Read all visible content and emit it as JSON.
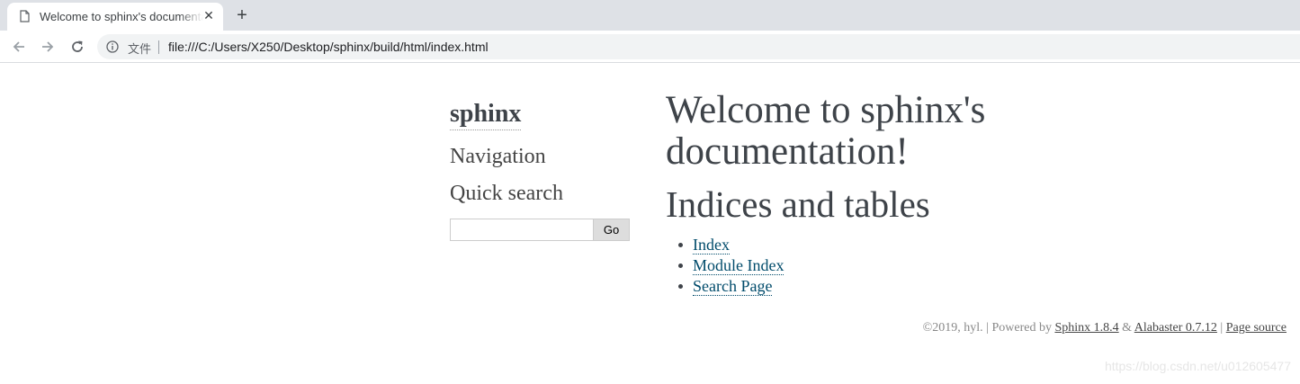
{
  "browser": {
    "tab_title": "Welcome to sphinx's documentation!",
    "tab_close_glyph": "✕",
    "new_tab_glyph": "+",
    "scheme_label": "文件",
    "url": "file:///C:/Users/X250/Desktop/sphinx/build/html/index.html"
  },
  "sidebar": {
    "logo": "sphinx",
    "navigation_heading": "Navigation",
    "quick_search_heading": "Quick search",
    "search_value": "",
    "go_label": "Go"
  },
  "main": {
    "title": "Welcome to sphinx's documentation!",
    "section_title": "Indices and tables",
    "links": [
      "Index",
      "Module Index",
      "Search Page"
    ]
  },
  "footer": {
    "copyright": "©2019, hyl.",
    "sep1": "|",
    "powered_by": "Powered by",
    "sphinx_link": "Sphinx 1.8.4",
    "amp": "&",
    "alabaster_link": "Alabaster 0.7.12",
    "sep2": "|",
    "source_link": "Page source"
  },
  "watermark": "https://blog.csdn.net/u012605477",
  "colors": {
    "link": "#004b6b",
    "text": "#3e4349",
    "tabstrip": "#dee1e6"
  },
  "icons": [
    "page-favicon-icon",
    "close-icon",
    "plus-icon",
    "back-arrow-icon",
    "forward-arrow-icon",
    "reload-icon",
    "info-icon"
  ]
}
